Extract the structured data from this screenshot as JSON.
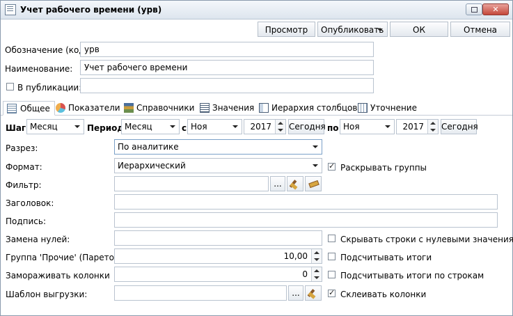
{
  "window": {
    "title": "Учет рабочего времени (урв)",
    "close_glyph": "✕"
  },
  "toolbar": {
    "preview": "Просмотр",
    "publish": "Опубликовать",
    "ok": "ОК",
    "cancel": "Отмена"
  },
  "header": {
    "code_label": "Обозначение (код):",
    "code_value": "урв",
    "name_label": "Наименование:",
    "name_value": "Учет рабочего времени",
    "publication_label": "В публикации:",
    "publication_checked": false
  },
  "tabs": [
    {
      "label": "Общее",
      "icon": "general-icon",
      "active": true
    },
    {
      "label": "Показатели",
      "icon": "indicators-icon",
      "active": false
    },
    {
      "label": "Справочники",
      "icon": "directories-icon",
      "active": false
    },
    {
      "label": "Значения",
      "icon": "values-icon",
      "active": false
    },
    {
      "label": "Иерархия столбцов",
      "icon": "hierarchy-icon",
      "active": false
    },
    {
      "label": "Уточнение",
      "icon": "refine-icon",
      "active": false
    }
  ],
  "period_row": {
    "step_label": "Шаг:",
    "step_value": "Месяц",
    "period_label": "Период:",
    "period_value": "Месяц",
    "from_label": "с",
    "from_month": "Ноя",
    "from_year": "2017",
    "today_label": "Сегодня",
    "to_label": "по",
    "to_month": "Ноя",
    "to_year": "2017",
    "today2_label": "Сегодня"
  },
  "form": {
    "slice_label": "Разрез:",
    "slice_value": "По аналитике",
    "format_label": "Формат:",
    "format_value": "Иерархический",
    "expand_groups_label": "Раскрывать группы",
    "expand_groups_checked": true,
    "filter_label": "Фильтр:",
    "filter_value": "",
    "ellipsis": "...",
    "heading_label": "Заголовок:",
    "heading_value": "",
    "caption_label": "Подпись:",
    "caption_value": "",
    "zero_replace_label": "Замена нулей:",
    "zero_replace_value": "",
    "hide_zero_rows_label": "Скрывать строки с нулевыми значениями",
    "hide_zero_rows_checked": false,
    "other_group_label": "Группа 'Прочие' (Парето), %",
    "other_group_value": "10,00",
    "count_totals_label": "Подсчитывать итоги",
    "count_totals_checked": false,
    "freeze_cols_label": "Замораживать колонки",
    "freeze_cols_value": "0",
    "count_row_totals_label": "Подсчитывать итоги по строкам",
    "count_row_totals_checked": false,
    "export_template_label": "Шаблон выгрузки:",
    "export_template_value": "",
    "merge_cols_label": "Склеивать колонки",
    "merge_cols_checked": true
  },
  "colors": {
    "accent_border": "#b9c3cf",
    "titlebar": "#dde5ee",
    "close_button": "#c4483b"
  }
}
